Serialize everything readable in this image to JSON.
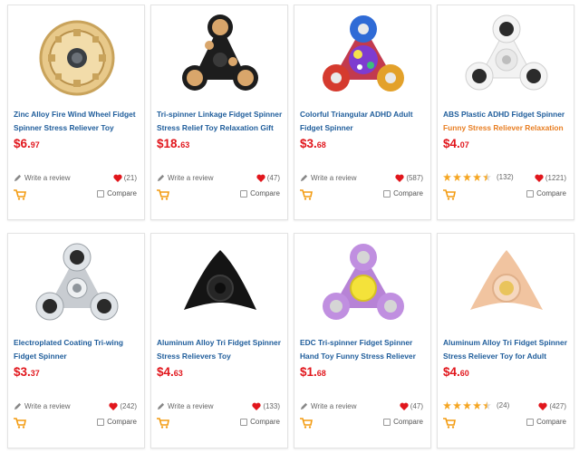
{
  "colors": {
    "title": "#1f5d9b",
    "price": "#e1161c",
    "heart": "#e1161c",
    "star": "#f5a623",
    "cart": "#f39c12",
    "subtitle_orange": "#e87e22"
  },
  "products": [
    {
      "title1": "Zinc Alloy Fire Wind Wheel Fidget",
      "title2": "Spinner Stress Reliever Toy",
      "price_main": "$6.",
      "price_cents": "97",
      "review_text": "Write a review",
      "likes": "(21)",
      "compare": "Compare",
      "image": "gold-wheel-spinner"
    },
    {
      "title1": "Tri-spinner Linkage Fidget Spinner",
      "title2": "Stress Relief Toy Relaxation Gift",
      "price_main": "$18.",
      "price_cents": "63",
      "review_text": "Write a review",
      "likes": "(47)",
      "compare": "Compare",
      "image": "black-gear-spinner"
    },
    {
      "title1": "Colorful Triangular ADHD Adult",
      "title2": "Fidget Spinner",
      "price_main": "$3.",
      "price_cents": "68",
      "review_text": "Write a review",
      "likes": "(587)",
      "compare": "Compare",
      "image": "colorful-spinner"
    },
    {
      "title1": "ABS Plastic ADHD Fidget Spinner",
      "title2": "Funny Stress Reliever Relaxation",
      "title2_orange": true,
      "price_main": "$4.",
      "price_cents": "07",
      "rating": 4.5,
      "rating_count": "(132)",
      "likes": "(1221)",
      "compare": "Compare",
      "image": "white-spinner"
    },
    {
      "title1": "Electroplated Coating Tri-wing",
      "title2": "Fidget Spinner",
      "price_main": "$3.",
      "price_cents": "37",
      "review_text": "Write a review",
      "likes": "(242)",
      "compare": "Compare",
      "image": "chrome-spinner"
    },
    {
      "title1": "Aluminum Alloy Tri Fidget Spinner",
      "title2": "Stress Relievers Toy",
      "price_main": "$4.",
      "price_cents": "63",
      "review_text": "Write a review",
      "likes": "(133)",
      "compare": "Compare",
      "image": "black-tri-spinner"
    },
    {
      "title1": "EDC Tri-spinner Fidget Spinner",
      "title2": "Hand Toy Funny Stress Reliever",
      "price_main": "$1.",
      "price_cents": "68",
      "review_text": "Write a review",
      "likes": "(47)",
      "compare": "Compare",
      "image": "purple-spinner"
    },
    {
      "title1": "Aluminum Alloy Tri Fidget Spinner",
      "title2": "Stress Reliever Toy for Adult",
      "price_main": "$4.",
      "price_cents": "60",
      "rating": 4.5,
      "rating_count": "(24)",
      "likes": "(427)",
      "compare": "Compare",
      "image": "rose-gold-spinner"
    }
  ]
}
